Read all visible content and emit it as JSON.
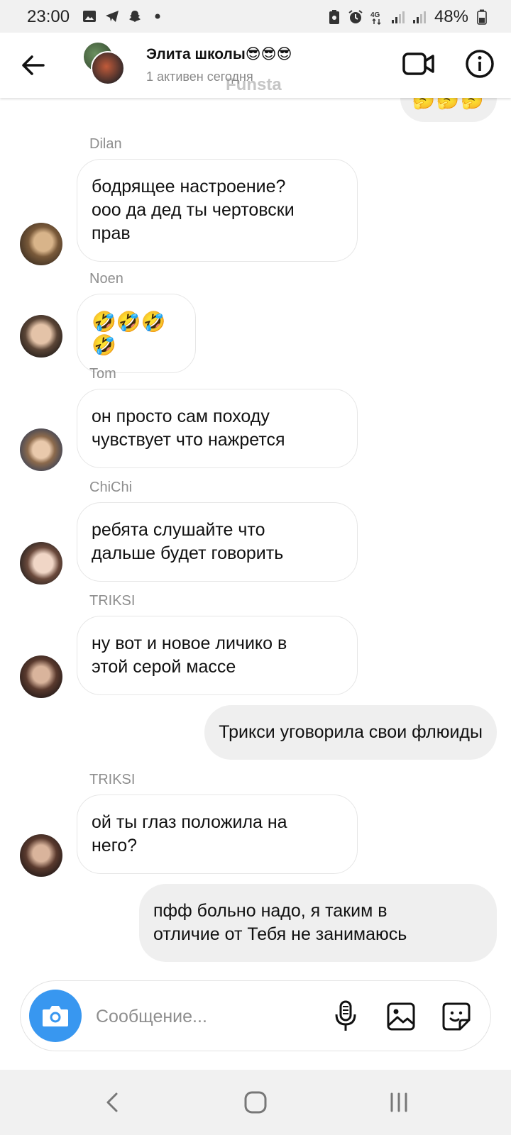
{
  "status_bar": {
    "time": "23:00",
    "battery": "48%",
    "network": "4G",
    "left_icons": [
      "image-icon",
      "telegram-icon",
      "snapchat-icon",
      "dot-icon"
    ],
    "right_icons": [
      "battery-saver-icon",
      "alarm-icon",
      "4g-icon",
      "signal-icon",
      "signal-icon",
      "battery-icon"
    ]
  },
  "header": {
    "title": "Элита школы😎😎😎",
    "subtitle": "1 активен сегодня",
    "watermark": "Funsta",
    "back_icon": "arrow-left-icon",
    "video_icon": "video-camera-icon",
    "info_icon": "info-icon"
  },
  "messages": {
    "partial_top": "🤔🤔🤔",
    "items": [
      {
        "sender": "Dilan",
        "text_lines": [
          "бодрящее настроение?",
          "ооо да дед ты чертовски",
          "прав"
        ]
      },
      {
        "sender": "Noen",
        "text": "🤣🤣🤣🤣"
      },
      {
        "sender": "Tom",
        "text_lines": [
          "он просто сам походу",
          "чувствует что нажрется"
        ]
      },
      {
        "sender": "ChiChi",
        "text_lines": [
          "ребята слушайте что",
          "дальше будет говорить"
        ]
      },
      {
        "sender": "TRIKSI",
        "text_lines": [
          "ну вот и новое личико в",
          "этой серой массе"
        ]
      },
      {
        "outgoing": true,
        "text": "Трикси уговорила свои флюиды"
      },
      {
        "sender": "TRIKSI",
        "text_lines": [
          "ой ты глаз положила на",
          "него?"
        ]
      },
      {
        "outgoing": true,
        "text_lines": [
          "пфф больно надо, я таким в",
          "отличие от Тебя не занимаюсь"
        ]
      }
    ]
  },
  "composer": {
    "placeholder": "Сообщение...",
    "accent": "#3897f0",
    "icons": [
      "camera-icon",
      "microphone-icon",
      "gallery-icon",
      "sticker-icon"
    ]
  },
  "navbar": {
    "icons": [
      "back-nav-icon",
      "home-nav-icon",
      "recents-nav-icon"
    ]
  }
}
